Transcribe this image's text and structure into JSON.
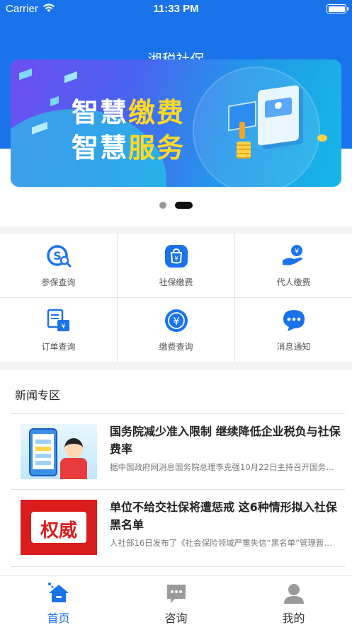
{
  "status_bar": {
    "carrier": "Carrier",
    "time": "11:33 PM"
  },
  "header": {
    "title": "湘税社保"
  },
  "banner": {
    "line1_white": "智慧",
    "line1_yellow": "缴费",
    "line2_white": "智慧",
    "line2_yellow": "服务",
    "page_count": 2,
    "active_page": 2
  },
  "services": [
    {
      "label": "参保查询",
      "icon": "insurance-search-icon"
    },
    {
      "label": "社保缴费",
      "icon": "social-security-payment-icon"
    },
    {
      "label": "代人缴费",
      "icon": "proxy-payment-icon"
    },
    {
      "label": "订单查询",
      "icon": "order-query-icon"
    },
    {
      "label": "缴费查询",
      "icon": "payment-query-icon"
    },
    {
      "label": "消息通知",
      "icon": "message-notification-icon"
    }
  ],
  "news": {
    "section_title": "新闻专区",
    "items": [
      {
        "headline": "国务院减少准入限制 继续降低企业税负与社保费率",
        "summary": "据中国政府网消息国务院总理李克强10月22日主持召开国务…",
        "thumb": "phone-and-man-illustration"
      },
      {
        "headline": "单位不给交社保将遭惩戒 这6种情形拟入社保黑名单",
        "summary": "人社部16日发布了《社会保险领域严重失信“黑名单”管理暂…",
        "thumb_text": "权威"
      }
    ]
  },
  "tabbar": [
    {
      "label": "首页",
      "icon": "home-icon",
      "active": true
    },
    {
      "label": "咨询",
      "icon": "chat-icon",
      "active": false
    },
    {
      "label": "我的",
      "icon": "user-icon",
      "active": false
    }
  ],
  "colors": {
    "primary": "#1a73ea",
    "accent_yellow": "#ffd92a",
    "banner_red": "#d91c1c"
  }
}
